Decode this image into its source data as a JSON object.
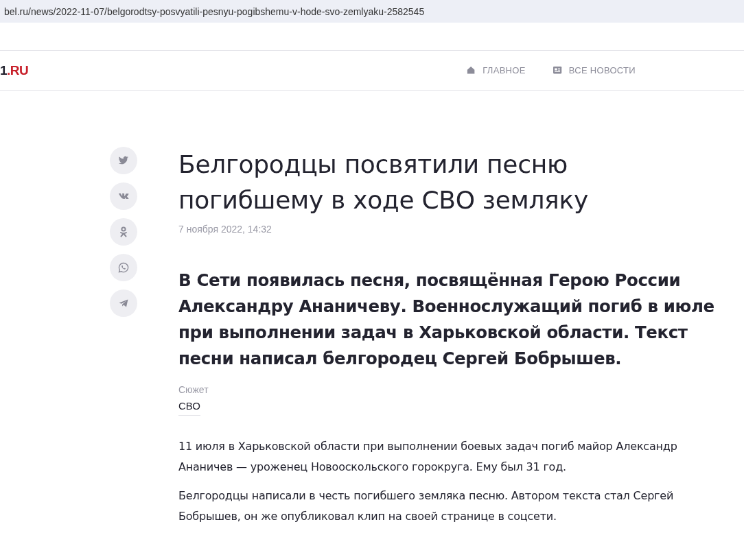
{
  "address_bar": {
    "url": "bel.ru/news/2022-11-07/belgorodtsy-posvyatili-pesnyu-pogibshemu-v-hode-svo-zemlyaku-2582545"
  },
  "header": {
    "logo": {
      "main": "1",
      "accent": ".RU"
    },
    "nav": [
      {
        "kind": "home",
        "label": "ГЛАВНОЕ"
      },
      {
        "kind": "news",
        "label": "ВСЕ НОВОСТИ"
      }
    ]
  },
  "share_buttons": [
    {
      "kind": "twitter"
    },
    {
      "kind": "vk"
    },
    {
      "kind": "ok"
    },
    {
      "kind": "whatsapp"
    },
    {
      "kind": "telegram"
    }
  ],
  "article": {
    "title": "Белгородцы посвятили песню погибшему в ходе СВО земляку",
    "date": "7 ноября 2022, 14:32",
    "lead": "В Сети появилась песня, посвящённая Герою России Александру Ананичеву. Военнослужащий погиб в июле при выполнении задач в Харьковской области. Текст песни написал белгородец Сергей Бобрышев.",
    "story_label": "Сюжет",
    "story_link": "СВО",
    "paragraphs": [
      "11 июля в Харьковской области при выполнении боевых задач погиб майор Александр Ананичев — уроженец Новооскольского горокруга. Ему был 31 год.",
      "Белгородцы написали в честь погибшего земляка песню. Автором текста стал Сергей Бобрышев, он же опубликовал клип на своей странице в соцсети."
    ]
  }
}
